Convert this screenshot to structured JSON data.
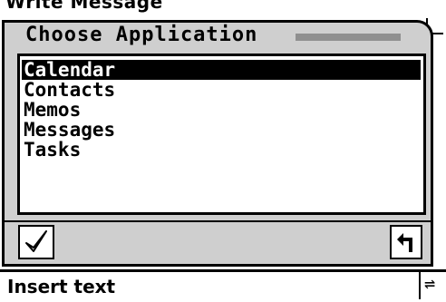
{
  "background_window": {
    "title": "Write Message",
    "insert_text": "Insert text",
    "right_glyph": "⇌"
  },
  "dialog": {
    "title": "Choose Application",
    "items": [
      {
        "label": "Calendar",
        "selected": true
      },
      {
        "label": "Contacts",
        "selected": false
      },
      {
        "label": "Memos",
        "selected": false
      },
      {
        "label": "Messages",
        "selected": false
      },
      {
        "label": "Tasks",
        "selected": false
      }
    ],
    "ok_icon": "checkmark-icon",
    "back_icon": "return-arrow-icon",
    "back_glyph": "↰"
  },
  "colors": {
    "dialog_bg": "#cfcfcf",
    "selection_bg": "#000000",
    "title_bar": "#8f8f8f"
  }
}
